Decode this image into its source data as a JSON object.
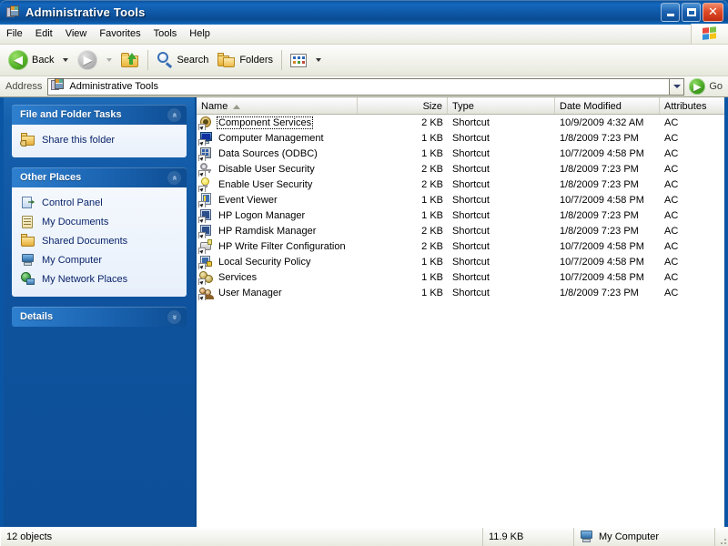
{
  "window": {
    "title": "Administrative Tools",
    "title_icon": "mmc-console-icon",
    "buttons": {
      "minimize": "Minimize",
      "maximize": "Maximize",
      "close": "Close"
    }
  },
  "menubar": {
    "items": [
      "File",
      "Edit",
      "View",
      "Favorites",
      "Tools",
      "Help"
    ],
    "brand_icon": "windows-flag-icon"
  },
  "toolbar": {
    "back_label": "Back",
    "back_icon": "back-arrow-icon",
    "forward_icon": "forward-arrow-icon",
    "up_icon": "up-one-level-icon",
    "search_label": "Search",
    "search_icon": "magnifier-icon",
    "folders_label": "Folders",
    "folders_icon": "folders-icon",
    "views_icon": "views-icon"
  },
  "address": {
    "label": "Address",
    "value": "Administrative Tools",
    "icon": "mmc-console-icon",
    "dropdown_icon": "chevron-down-icon",
    "go_label": "Go",
    "go_icon": "go-arrow-icon"
  },
  "sidebar": {
    "panels": [
      {
        "title": "File and Folder Tasks",
        "chevron": "«",
        "state": "expanded",
        "items": [
          {
            "label": "Share this folder",
            "icon": "shared-folder-icon"
          }
        ]
      },
      {
        "title": "Other Places",
        "chevron": "«",
        "state": "expanded",
        "items": [
          {
            "label": "Control Panel",
            "icon": "control-panel-icon"
          },
          {
            "label": "My Documents",
            "icon": "my-documents-icon"
          },
          {
            "label": "Shared Documents",
            "icon": "folder-icon"
          },
          {
            "label": "My Computer",
            "icon": "my-computer-icon"
          },
          {
            "label": "My Network Places",
            "icon": "network-places-icon"
          }
        ]
      },
      {
        "title": "Details",
        "chevron": "»",
        "state": "collapsed",
        "items": []
      }
    ]
  },
  "listview": {
    "columns": [
      {
        "key": "name",
        "label": "Name",
        "width": 177,
        "align": "left",
        "sorted": "asc"
      },
      {
        "key": "size",
        "label": "Size",
        "width": 99,
        "align": "right"
      },
      {
        "key": "type",
        "label": "Type",
        "width": 118,
        "align": "left"
      },
      {
        "key": "date",
        "label": "Date Modified",
        "width": 115,
        "align": "left"
      },
      {
        "key": "attrs",
        "label": "Attributes",
        "width": 71,
        "align": "left"
      }
    ],
    "rows": [
      {
        "name": "Component Services",
        "icon": "component-services-icon",
        "size": "2 KB",
        "type": "Shortcut",
        "date": "10/9/2009 4:32 AM",
        "attrs": "AC",
        "focused": true
      },
      {
        "name": "Computer Management",
        "icon": "computer-management-icon",
        "size": "1 KB",
        "type": "Shortcut",
        "date": "1/8/2009 7:23 PM",
        "attrs": "AC",
        "focused": false
      },
      {
        "name": "Data Sources (ODBC)",
        "icon": "odbc-icon",
        "size": "1 KB",
        "type": "Shortcut",
        "date": "10/7/2009 4:58 PM",
        "attrs": "AC",
        "focused": false
      },
      {
        "name": "Disable User Security",
        "icon": "key-icon",
        "size": "2 KB",
        "type": "Shortcut",
        "date": "1/8/2009 7:23 PM",
        "attrs": "AC",
        "focused": false
      },
      {
        "name": "Enable User Security",
        "icon": "lightbulb-icon",
        "size": "2 KB",
        "type": "Shortcut",
        "date": "1/8/2009 7:23 PM",
        "attrs": "AC",
        "focused": false
      },
      {
        "name": "Event Viewer",
        "icon": "event-viewer-icon",
        "size": "1 KB",
        "type": "Shortcut",
        "date": "10/7/2009 4:58 PM",
        "attrs": "AC",
        "focused": false
      },
      {
        "name": "HP Logon Manager",
        "icon": "hp-config-icon",
        "size": "1 KB",
        "type": "Shortcut",
        "date": "1/8/2009 7:23 PM",
        "attrs": "AC",
        "focused": false
      },
      {
        "name": "HP Ramdisk Manager",
        "icon": "hp-config-icon",
        "size": "2 KB",
        "type": "Shortcut",
        "date": "1/8/2009 7:23 PM",
        "attrs": "AC",
        "focused": false
      },
      {
        "name": "HP Write Filter Configuration",
        "icon": "write-filter-icon",
        "size": "2 KB",
        "type": "Shortcut",
        "date": "10/7/2009 4:58 PM",
        "attrs": "AC",
        "focused": false
      },
      {
        "name": "Local Security Policy",
        "icon": "security-policy-icon",
        "size": "1 KB",
        "type": "Shortcut",
        "date": "10/7/2009 4:58 PM",
        "attrs": "AC",
        "focused": false
      },
      {
        "name": "Services",
        "icon": "services-gears-icon",
        "size": "1 KB",
        "type": "Shortcut",
        "date": "10/7/2009 4:58 PM",
        "attrs": "AC",
        "focused": false
      },
      {
        "name": "User Manager",
        "icon": "user-manager-icon",
        "size": "1 KB",
        "type": "Shortcut",
        "date": "1/8/2009 7:23 PM",
        "attrs": "AC",
        "focused": false
      }
    ]
  },
  "statusbar": {
    "object_count": "12 objects",
    "total_size": "11.9 KB",
    "zone": "My Computer",
    "zone_icon": "my-computer-icon"
  },
  "colors": {
    "title_blue": "#0f59a8",
    "sidebar_blue": "#0f539e",
    "panel_header_blue": "#1a63b0",
    "link_text": "#0a246a",
    "close_red": "#e04b28"
  }
}
